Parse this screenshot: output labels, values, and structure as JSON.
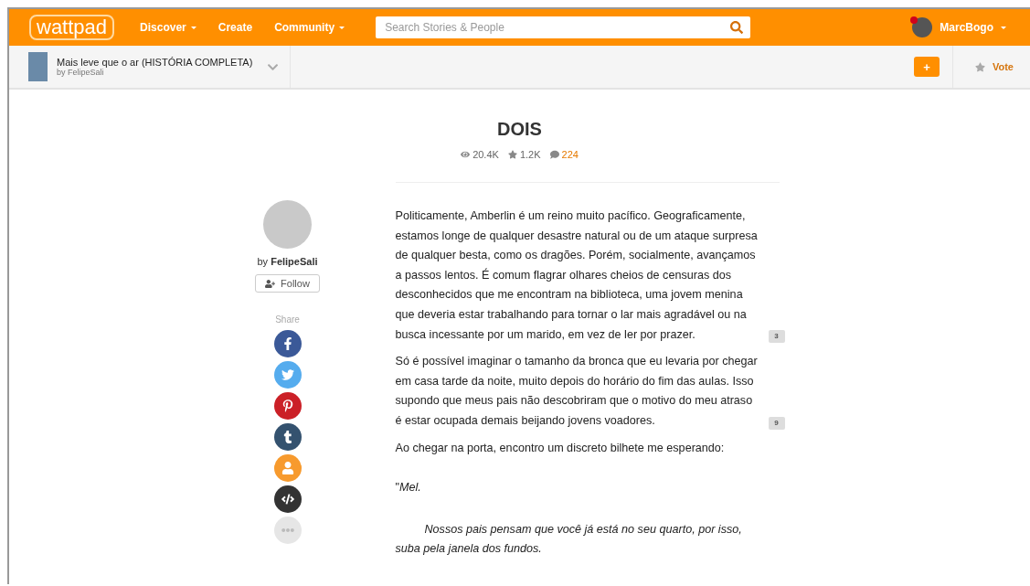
{
  "header": {
    "logo": "wattpad",
    "nav": [
      {
        "label": "Discover",
        "has_menu": true
      },
      {
        "label": "Create",
        "has_menu": false
      },
      {
        "label": "Community",
        "has_menu": true
      }
    ],
    "search": {
      "placeholder": "Search Stories & People"
    },
    "user": {
      "name": "MarcBogo",
      "notification": true
    }
  },
  "story_bar": {
    "title": "Mais leve que o ar (HISTÓRIA COMPLETA)",
    "author": "by FelipeSali",
    "add_label": "+",
    "vote_label": "Vote"
  },
  "chapter": {
    "title": "DOIS",
    "stats": [
      {
        "kind": "views",
        "value": "20.4K"
      },
      {
        "kind": "votes",
        "value": "1.2K"
      },
      {
        "kind": "comments",
        "value": "224"
      }
    ]
  },
  "author": {
    "prefix": "by",
    "name": "FelipeSali",
    "follow_label": "Follow"
  },
  "share": {
    "label": "Share",
    "items": [
      {
        "kind": "facebook",
        "color": "#3b5998"
      },
      {
        "kind": "twitter",
        "color": "#55acee"
      },
      {
        "kind": "pinterest",
        "color": "#cb2027"
      },
      {
        "kind": "tumblr",
        "color": "#34526f"
      },
      {
        "kind": "profile",
        "color": "#f79a2d"
      },
      {
        "kind": "embed",
        "color": "#333333"
      },
      {
        "kind": "more",
        "color": "#e6e6e6"
      }
    ]
  },
  "paragraphs": [
    {
      "kind": "plain",
      "text": "Politicamente, Amberlin é um reino muito pacífico. Geograficamente, estamos longe de qualquer desastre natural ou de um ataque surpresa de qualquer besta, como os dragões. Porém, socialmente, avançamos a passos lentos. É comum flagrar olhares cheios de censuras dos desconhecidos que me encontram na biblioteca, uma jovem menina que deveria estar trabalhando para tornar o lar mais agradável ou na busca incessante por um marido, em vez de ler por prazer.",
      "comments": "3"
    },
    {
      "kind": "plain",
      "text": "Só é possível imaginar o tamanho da bronca que eu levaria por chegar em casa tarde da noite, muito depois do horário do fim das aulas. Isso supondo que meus pais não descobriram que o motivo do meu atraso é estar ocupada demais beijando jovens voadores.",
      "comments": "9"
    },
    {
      "kind": "plain",
      "text": "Ao chegar na porta, encontro um discreto bilhete me esperando:"
    },
    {
      "kind": "spaced",
      "text": "\"*Mel.*"
    },
    {
      "kind": "indented-italic",
      "text": "Nossos pais pensam que você já está no seu quarto, por isso, suba pela janela dos fundos."
    }
  ]
}
